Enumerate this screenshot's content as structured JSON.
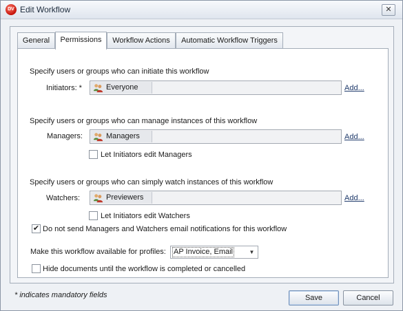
{
  "window": {
    "title": "Edit Workflow",
    "app_icon_text": "DV"
  },
  "tabs": [
    {
      "label": "General",
      "active": false
    },
    {
      "label": "Permissions",
      "active": true
    },
    {
      "label": "Workflow Actions",
      "active": false
    },
    {
      "label": "Automatic Workflow Triggers",
      "active": false
    }
  ],
  "initiators": {
    "description": "Specify users or groups who can initiate this workflow",
    "label": "Initiators: *",
    "value": "Everyone",
    "add_link": "Add..."
  },
  "managers": {
    "description": "Specify users or groups who can manage instances of this workflow",
    "label": "Managers:",
    "value": "Managers",
    "add_link": "Add...",
    "checkbox_label": "Let Initiators edit Managers",
    "checkbox_checked": false
  },
  "watchers": {
    "description": "Specify users or groups who can simply watch instances of this workflow",
    "label": "Watchers:",
    "value": "Previewers",
    "add_link": "Add...",
    "checkbox_label": "Let Initiators edit Watchers",
    "checkbox_checked": false
  },
  "no_email": {
    "label": "Do not send Managers and Watchers email notifications for this workflow",
    "checked": true
  },
  "profiles": {
    "label": "Make this workflow available for profiles:",
    "value": "AP Invoice, Email"
  },
  "hide_docs": {
    "label": "Hide documents until the workflow is completed or cancelled",
    "checked": false
  },
  "footer": {
    "mandatory_note": "* indicates mandatory fields",
    "save_label": "Save",
    "cancel_label": "Cancel"
  }
}
